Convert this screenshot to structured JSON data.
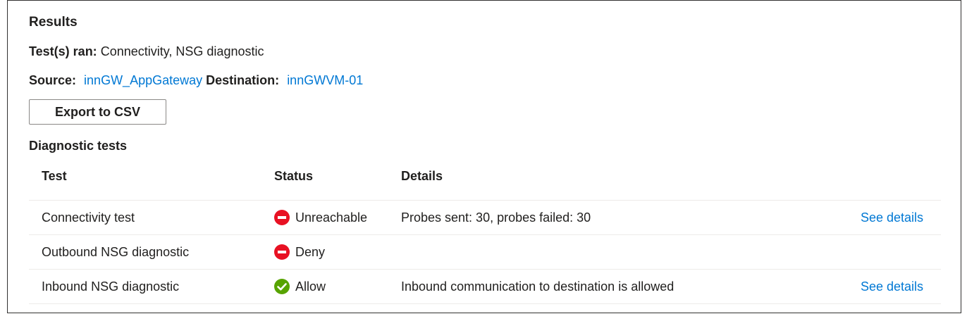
{
  "results": {
    "heading": "Results",
    "tests_ran_label": "Test(s) ran:",
    "tests_ran_value": "Connectivity, NSG diagnostic",
    "source_label": "Source:",
    "source_value": "innGW_AppGateway",
    "destination_label": "Destination:",
    "destination_value": "innGWVM-01",
    "export_button": "Export to CSV"
  },
  "diagnostic": {
    "heading": "Diagnostic tests",
    "columns": {
      "test": "Test",
      "status": "Status",
      "details": "Details"
    },
    "rows": [
      {
        "test": "Connectivity test",
        "status": "Unreachable",
        "status_icon": "blocked-icon",
        "details": "Probes sent: 30, probes failed: 30",
        "link": "See details"
      },
      {
        "test": "Outbound NSG diagnostic",
        "status": "Deny",
        "status_icon": "blocked-icon",
        "details": "",
        "link": ""
      },
      {
        "test": "Inbound NSG diagnostic",
        "status": "Allow",
        "status_icon": "check-circle-icon",
        "details": "Inbound communication to destination is allowed",
        "link": "See details"
      }
    ]
  },
  "colors": {
    "link": "#0078d4",
    "error": "#e81123",
    "success": "#57a300"
  }
}
